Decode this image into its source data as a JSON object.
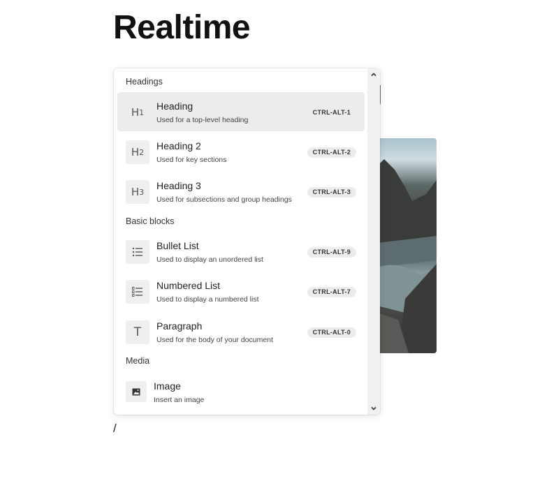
{
  "document": {
    "title": "Realtime",
    "peek_heading_fragment": "g",
    "cursor_text": "/"
  },
  "menu": {
    "groups": [
      {
        "label": "Headings",
        "items": [
          {
            "icon": "heading-1-icon",
            "title": "Heading",
            "description": "Used for a top-level heading",
            "shortcut": "CTRL-ALT-1",
            "active": true
          },
          {
            "icon": "heading-2-icon",
            "title": "Heading 2",
            "description": "Used for key sections",
            "shortcut": "CTRL-ALT-2"
          },
          {
            "icon": "heading-3-icon",
            "title": "Heading 3",
            "description": "Used for subsections and group headings",
            "shortcut": "CTRL-ALT-3"
          }
        ]
      },
      {
        "label": "Basic blocks",
        "items": [
          {
            "icon": "bullet-list-icon",
            "title": "Bullet List",
            "description": "Used to display an unordered list",
            "shortcut": "CTRL-ALT-9"
          },
          {
            "icon": "numbered-list-icon",
            "title": "Numbered List",
            "description": "Used to display a numbered list",
            "shortcut": "CTRL-ALT-7"
          },
          {
            "icon": "paragraph-icon",
            "title": "Paragraph",
            "description": "Used for the body of your document",
            "shortcut": "CTRL-ALT-0"
          }
        ]
      },
      {
        "label": "Media",
        "items": [
          {
            "icon": "image-icon",
            "title": "Image",
            "description": "Insert an image"
          }
        ]
      }
    ]
  }
}
